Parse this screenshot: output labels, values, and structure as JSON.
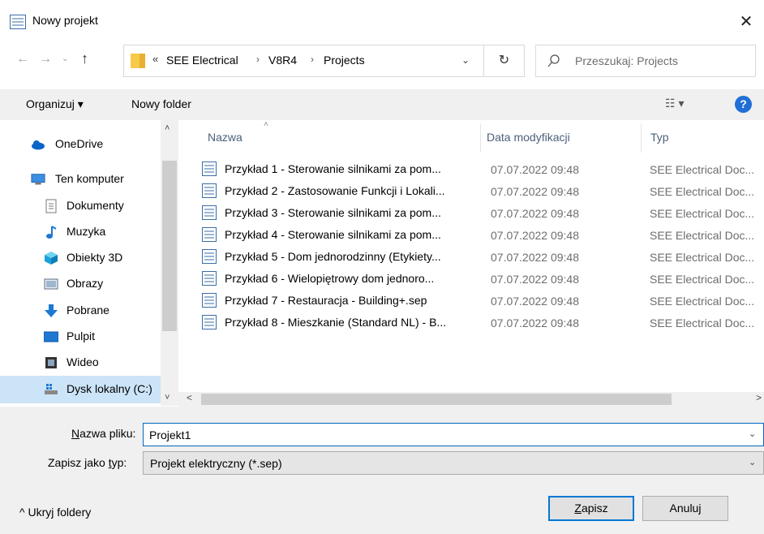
{
  "window": {
    "title": "Nowy projekt",
    "close_glyph": "✕"
  },
  "nav": {
    "back_glyph": "←",
    "forward_glyph": "→",
    "recent_glyph": "⌄",
    "up_glyph": "↑",
    "breadcrumb_prefix": "«",
    "breadcrumb": [
      "SEE Electrical",
      "V8R4",
      "Projects"
    ],
    "separator": "›",
    "dropdown_glyph": "⌄",
    "refresh_glyph": "↻",
    "search_placeholder": "Przeszukaj: Projects"
  },
  "toolbar": {
    "organize_label": "Organizuj ▾",
    "new_folder_label": "Nowy folder",
    "view_glyph": "☷ ▾",
    "help_glyph": "?"
  },
  "sidebar": {
    "scroll_up": "˄",
    "scroll_down": "˅",
    "items": [
      {
        "label": "OneDrive",
        "icon": "cloud-icon"
      },
      {
        "label": "Ten komputer",
        "icon": "computer-icon"
      },
      {
        "label": "Dokumenty",
        "icon": "documents-icon"
      },
      {
        "label": "Muzyka",
        "icon": "music-icon"
      },
      {
        "label": "Obiekty 3D",
        "icon": "objects-3d-icon"
      },
      {
        "label": "Obrazy",
        "icon": "pictures-icon"
      },
      {
        "label": "Pobrane",
        "icon": "downloads-icon"
      },
      {
        "label": "Pulpit",
        "icon": "desktop-icon"
      },
      {
        "label": "Wideo",
        "icon": "video-icon"
      },
      {
        "label": "Dysk lokalny (C:)",
        "icon": "local-disk-icon"
      }
    ]
  },
  "filelist": {
    "columns": {
      "name": "Nazwa",
      "date": "Data modyfikacji",
      "type": "Typ"
    },
    "sort_glyph": "˄",
    "files": [
      {
        "name": "Przykład 1 - Sterowanie silnikami za pom...",
        "date": "07.07.2022 09:48",
        "type": "SEE Electrical Doc..."
      },
      {
        "name": "Przykład 2 - Zastosowanie Funkcji i Lokali...",
        "date": "07.07.2022 09:48",
        "type": "SEE Electrical Doc..."
      },
      {
        "name": "Przykład 3 - Sterowanie silnikami za pom...",
        "date": "07.07.2022 09:48",
        "type": "SEE Electrical Doc..."
      },
      {
        "name": "Przykład 4 - Sterowanie silnikami za pom...",
        "date": "07.07.2022 09:48",
        "type": "SEE Electrical Doc..."
      },
      {
        "name": "Przykład 5 - Dom jednorodzinny (Etykiety...",
        "date": "07.07.2022 09:48",
        "type": "SEE Electrical Doc..."
      },
      {
        "name": "Przykład 6 - Wielopiętrowy dom jednoro...",
        "date": "07.07.2022 09:48",
        "type": "SEE Electrical Doc..."
      },
      {
        "name": "Przykład 7 - Restauracja - Building+.sep",
        "date": "07.07.2022 09:48",
        "type": "SEE Electrical Doc..."
      },
      {
        "name": "Przykład 8 - Mieszkanie (Standard NL) - B...",
        "date": "07.07.2022 09:48",
        "type": "SEE Electrical Doc..."
      }
    ],
    "hscroll_left": "<",
    "hscroll_right": ">"
  },
  "form": {
    "filename_label_key": "N",
    "filename_label_rest": "azwa pliku:",
    "filename_value": "Projekt1",
    "dropdown_glyph": "⌄",
    "type_label_pre": "Zapisz jako ",
    "type_label_key": "t",
    "type_label_rest": "yp:",
    "type_value": "Projekt elektryczny (*.sep)"
  },
  "footer": {
    "hide_folders_label": "^  Ukryj foldery",
    "save_key": "Z",
    "save_rest": "apisz",
    "cancel_label": "Anuluj"
  },
  "colors": {
    "accent": "#0078d4",
    "selected": "#cce4f7",
    "chrome": "#f0f0f0",
    "header_text": "#4c607a"
  }
}
